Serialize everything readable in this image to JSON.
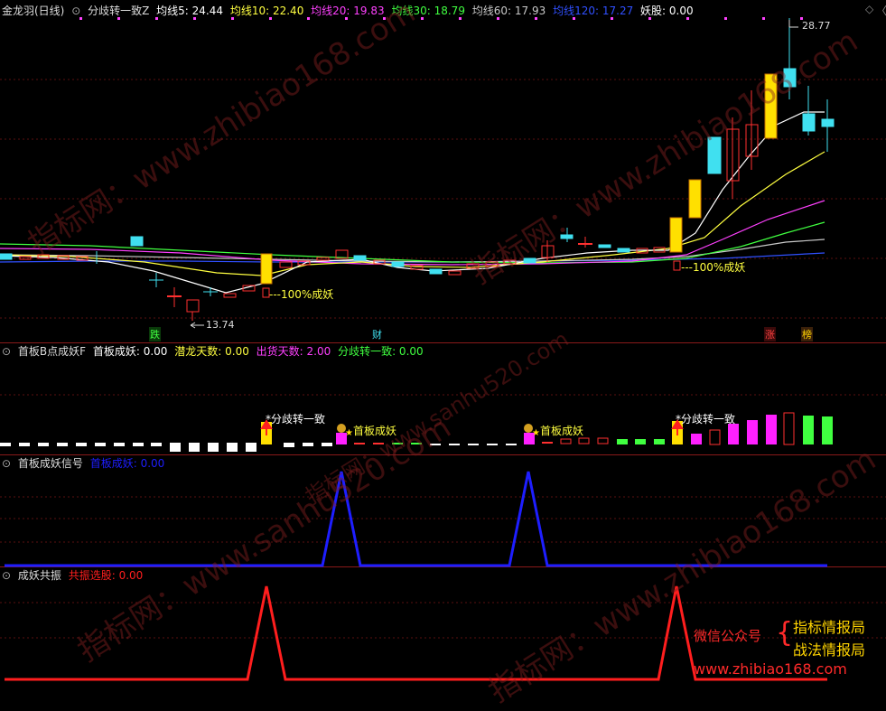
{
  "panels": {
    "main": {
      "title": "金龙羽(日线)",
      "indicator": "分歧转一致Z",
      "ma": [
        {
          "label": "均线5: 24.44",
          "color": "#ffffff"
        },
        {
          "label": "均线10: 22.40",
          "color": "#ffff40"
        },
        {
          "label": "均线20: 19.83",
          "color": "#ff40ff"
        },
        {
          "label": "均线30: 18.79",
          "color": "#40ff40"
        },
        {
          "label": "均线60: 17.93",
          "color": "#c8c8c8"
        },
        {
          "label": "均线120: 17.27",
          "color": "#3050ff"
        },
        {
          "label": "妖股: 0.00",
          "color": "#ffffff"
        }
      ],
      "price_high": "28.77",
      "price_low": "13.74",
      "annot_left": "100%成妖",
      "annot_right": "100%成妖",
      "markers": {
        "die": "跌",
        "cai": "财",
        "zhang": "涨",
        "bang": "榜"
      }
    },
    "p2": {
      "title": "首板B点成妖F",
      "fields": [
        {
          "label": "首板成妖: 0.00",
          "color": "#ffffff"
        },
        {
          "label": "潜龙天数: 0.00",
          "color": "#ffff40"
        },
        {
          "label": "出货天数: 2.00",
          "color": "#ff40ff"
        },
        {
          "label": "分歧转一致: 0.00",
          "color": "#40ff40"
        }
      ],
      "sig_fz1": "*分歧转一致",
      "sig_sb1": "首板成妖",
      "sig_sb2": "首板成妖",
      "sig_fz2": "*分歧转一致"
    },
    "p3": {
      "title": "首板成妖信号",
      "field": "首板成妖: 0.00"
    },
    "p4": {
      "title": "成妖共振",
      "field": "共振选股: 0.00"
    }
  },
  "watermarks": {
    "wm1": "指标网：www.zhibiao168.com",
    "wm2": "指标网：www.sanhu520.com"
  },
  "ad": {
    "label": "微信公众号",
    "line1": "指标情报局",
    "line2": "战法情报局",
    "url": "www.zhibiao168.com"
  },
  "colors": {
    "ma5": "#ffffff",
    "ma10": "#ffff40",
    "ma20": "#ff40ff",
    "ma30": "#40ff40",
    "ma60": "#c8c8c8",
    "ma120": "#3050ff",
    "up": "#ff3030",
    "down": "#40e0f0",
    "limit": "#ffe000",
    "signal_blue": "#1e1eff",
    "signal_red": "#ff1e1e"
  }
}
